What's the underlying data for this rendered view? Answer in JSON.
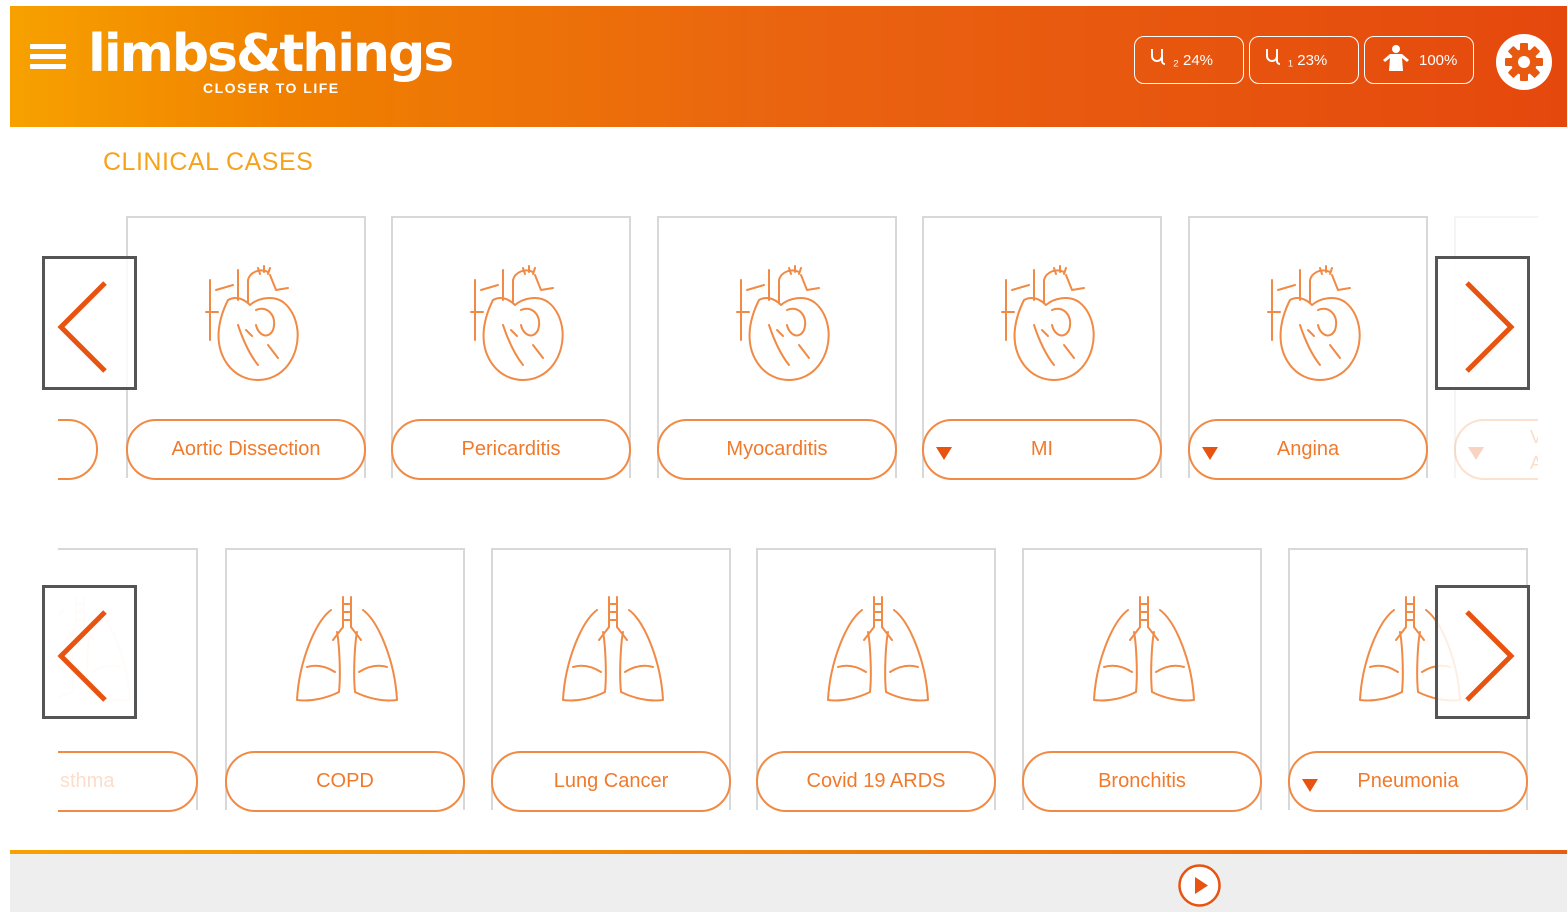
{
  "header": {
    "logo_main": "limbs&things",
    "logo_sub": "CLOSER TO LIFE",
    "stats": [
      {
        "icon": "stethoscope-icon",
        "icon_glyph": "⛑",
        "label": "₂ 24%"
      },
      {
        "icon": "stethoscope-icon",
        "icon_glyph": "⛑",
        "label": "₁ 23%"
      },
      {
        "icon": "body-icon",
        "icon_glyph": "",
        "label": "100%"
      }
    ]
  },
  "section_title": "CLINICAL CASES",
  "row1": {
    "partial_left": "",
    "cards": [
      {
        "label": "Aortic Dissection",
        "icon": "heart-icon",
        "expandable": false
      },
      {
        "label": "Pericarditis",
        "icon": "heart-icon",
        "expandable": false
      },
      {
        "label": "Myocarditis",
        "icon": "heart-icon",
        "expandable": false
      },
      {
        "label": "MI",
        "icon": "heart-icon",
        "expandable": true
      },
      {
        "label": "Angina",
        "icon": "heart-icon",
        "expandable": true
      }
    ],
    "partial_right": "V\nA"
  },
  "row2": {
    "partial_left": "sthma",
    "cards": [
      {
        "label": "COPD",
        "icon": "lungs-icon",
        "expandable": false
      },
      {
        "label": "Lung Cancer",
        "icon": "lungs-icon",
        "expandable": false
      },
      {
        "label": "Covid 19 ARDS",
        "icon": "lungs-icon",
        "expandable": false
      },
      {
        "label": "Bronchitis",
        "icon": "lungs-icon",
        "expandable": false
      }
    ],
    "partial_right": "Pneumonia"
  },
  "colors": {
    "accent": "#e8530f",
    "title": "#f7a21b",
    "card_text": "#f07a2c"
  }
}
